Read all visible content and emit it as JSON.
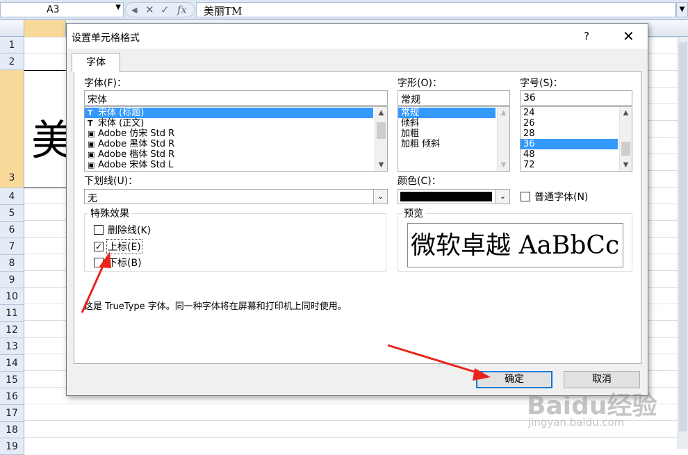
{
  "excel": {
    "name_box": "A3",
    "formula_content": "美丽TM",
    "rows": [
      "1",
      "2",
      "3",
      "4",
      "5",
      "6",
      "7",
      "8",
      "9",
      "10",
      "11",
      "12",
      "13",
      "14",
      "15",
      "16",
      "17",
      "18",
      "19"
    ],
    "cell_a3_text": "美"
  },
  "dialog": {
    "title": "设置单元格格式",
    "help": "?",
    "close": "✕",
    "tab": "字体",
    "font_label": "字体(F)：",
    "font_value": "宋体",
    "font_list": [
      {
        "icon": "T",
        "label": "宋体 (标题)",
        "selected": true
      },
      {
        "icon": "T",
        "label": "宋体 (正文)",
        "selected": false
      },
      {
        "icon": "▣",
        "label": "Adobe 仿宋 Std R",
        "selected": false
      },
      {
        "icon": "▣",
        "label": "Adobe 黑体 Std R",
        "selected": false
      },
      {
        "icon": "▣",
        "label": "Adobe 楷体 Std R",
        "selected": false
      },
      {
        "icon": "▣",
        "label": "Adobe 宋体 Std L",
        "selected": false
      }
    ],
    "style_label": "字形(O)：",
    "style_value": "常规",
    "style_list": [
      {
        "label": "常规",
        "selected": true
      },
      {
        "label": "倾斜",
        "selected": false
      },
      {
        "label": "加粗",
        "selected": false
      },
      {
        "label": "加粗 倾斜",
        "selected": false
      }
    ],
    "size_label": "字号(S)：",
    "size_value": "36",
    "size_list": [
      {
        "label": "24",
        "selected": false
      },
      {
        "label": "26",
        "selected": false
      },
      {
        "label": "28",
        "selected": false
      },
      {
        "label": "36",
        "selected": true
      },
      {
        "label": "48",
        "selected": false
      },
      {
        "label": "72",
        "selected": false
      }
    ],
    "underline_label": "下划线(U)：",
    "underline_value": "无",
    "color_label": "颜色(C)：",
    "color_value": "#000000",
    "normal_font_label": "普通字体(N)",
    "effects_title": "特殊效果",
    "strikethrough_label": "删除线(K)",
    "superscript_label": "上标(E)",
    "subscript_label": "下标(B)",
    "strikethrough_checked": false,
    "superscript_checked": true,
    "subscript_checked": false,
    "preview_title": "预览",
    "preview_text": "微软卓越  AaBbCc",
    "info_text": "这是 TrueType 字体。同一种字体将在屏幕和打印机上同时使用。",
    "ok_label": "确定",
    "cancel_label": "取消"
  },
  "watermark": {
    "line1": "Baidu经验",
    "line2": "jingyan.baidu.com"
  },
  "annotation_color": "#e8241c"
}
